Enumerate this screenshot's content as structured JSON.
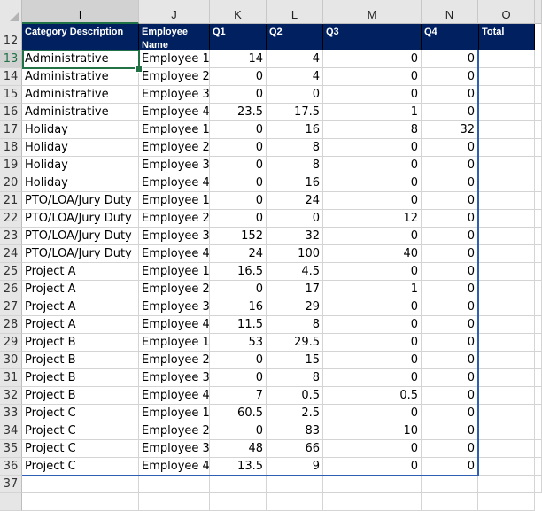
{
  "spreadsheet": {
    "columns": [
      "I",
      "J",
      "K",
      "L",
      "M",
      "N",
      "O"
    ],
    "selected_column": "I",
    "active_cell": "I13",
    "header_row_number": "12",
    "headers": [
      "Category Description",
      "Employee Name",
      "Q1",
      "Q2",
      "Q3",
      "Q4",
      "Total"
    ],
    "rows": [
      {
        "row": "13",
        "category": "Administrative",
        "employee": "Employee 1",
        "q1": "14",
        "q2": "4",
        "q3": "0",
        "q4": "0",
        "total": ""
      },
      {
        "row": "14",
        "category": "Administrative",
        "employee": "Employee 2",
        "q1": "0",
        "q2": "4",
        "q3": "0",
        "q4": "0",
        "total": ""
      },
      {
        "row": "15",
        "category": "Administrative",
        "employee": "Employee 3",
        "q1": "0",
        "q2": "0",
        "q3": "0",
        "q4": "0",
        "total": ""
      },
      {
        "row": "16",
        "category": "Administrative",
        "employee": "Employee 4",
        "q1": "23.5",
        "q2": "17.5",
        "q3": "1",
        "q4": "0",
        "total": ""
      },
      {
        "row": "17",
        "category": "Holiday",
        "employee": "Employee 1",
        "q1": "0",
        "q2": "16",
        "q3": "8",
        "q4": "32",
        "total": ""
      },
      {
        "row": "18",
        "category": "Holiday",
        "employee": "Employee 2",
        "q1": "0",
        "q2": "8",
        "q3": "0",
        "q4": "0",
        "total": ""
      },
      {
        "row": "19",
        "category": "Holiday",
        "employee": "Employee 3",
        "q1": "0",
        "q2": "8",
        "q3": "0",
        "q4": "0",
        "total": ""
      },
      {
        "row": "20",
        "category": "Holiday",
        "employee": "Employee 4",
        "q1": "0",
        "q2": "16",
        "q3": "0",
        "q4": "0",
        "total": ""
      },
      {
        "row": "21",
        "category": "PTO/LOA/Jury Duty",
        "employee": "Employee 1",
        "q1": "0",
        "q2": "24",
        "q3": "0",
        "q4": "0",
        "total": ""
      },
      {
        "row": "22",
        "category": "PTO/LOA/Jury Duty",
        "employee": "Employee 2",
        "q1": "0",
        "q2": "0",
        "q3": "12",
        "q4": "0",
        "total": ""
      },
      {
        "row": "23",
        "category": "PTO/LOA/Jury Duty",
        "employee": "Employee 3",
        "q1": "152",
        "q2": "32",
        "q3": "0",
        "q4": "0",
        "total": ""
      },
      {
        "row": "24",
        "category": "PTO/LOA/Jury Duty",
        "employee": "Employee 4",
        "q1": "24",
        "q2": "100",
        "q3": "40",
        "q4": "0",
        "total": ""
      },
      {
        "row": "25",
        "category": "Project A",
        "employee": "Employee 1",
        "q1": "16.5",
        "q2": "4.5",
        "q3": "0",
        "q4": "0",
        "total": ""
      },
      {
        "row": "26",
        "category": "Project A",
        "employee": "Employee 2",
        "q1": "0",
        "q2": "17",
        "q3": "1",
        "q4": "0",
        "total": ""
      },
      {
        "row": "27",
        "category": "Project A",
        "employee": "Employee 3",
        "q1": "16",
        "q2": "29",
        "q3": "0",
        "q4": "0",
        "total": ""
      },
      {
        "row": "28",
        "category": "Project A",
        "employee": "Employee 4",
        "q1": "11.5",
        "q2": "8",
        "q3": "0",
        "q4": "0",
        "total": ""
      },
      {
        "row": "29",
        "category": "Project B",
        "employee": "Employee 1",
        "q1": "53",
        "q2": "29.5",
        "q3": "0",
        "q4": "0",
        "total": ""
      },
      {
        "row": "30",
        "category": "Project B",
        "employee": "Employee 2",
        "q1": "0",
        "q2": "15",
        "q3": "0",
        "q4": "0",
        "total": ""
      },
      {
        "row": "31",
        "category": "Project B",
        "employee": "Employee 3",
        "q1": "0",
        "q2": "8",
        "q3": "0",
        "q4": "0",
        "total": ""
      },
      {
        "row": "32",
        "category": "Project B",
        "employee": "Employee 4",
        "q1": "7",
        "q2": "0.5",
        "q3": "0.5",
        "q4": "0",
        "total": ""
      },
      {
        "row": "33",
        "category": "Project C",
        "employee": "Employee 1",
        "q1": "60.5",
        "q2": "2.5",
        "q3": "0",
        "q4": "0",
        "total": ""
      },
      {
        "row": "34",
        "category": "Project C",
        "employee": "Employee 2",
        "q1": "0",
        "q2": "83",
        "q3": "10",
        "q4": "0",
        "total": ""
      },
      {
        "row": "35",
        "category": "Project C",
        "employee": "Employee 3",
        "q1": "48",
        "q2": "66",
        "q3": "0",
        "q4": "0",
        "total": ""
      },
      {
        "row": "36",
        "category": "Project C",
        "employee": "Employee 4",
        "q1": "13.5",
        "q2": "9",
        "q3": "0",
        "q4": "0",
        "total": ""
      }
    ],
    "empty_rows": [
      "37"
    ],
    "colors": {
      "header_fill": "#002060",
      "header_text": "#ffffff",
      "selection": "#217346",
      "table_border": "#2f5fb3"
    }
  }
}
